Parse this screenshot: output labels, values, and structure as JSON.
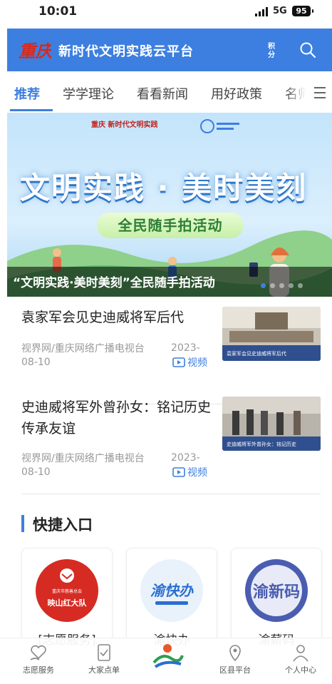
{
  "status_bar": {
    "time": "10:01",
    "network": "5G",
    "battery": "95"
  },
  "header": {
    "logo_text": "重庆",
    "title": "新时代文明实践云平台",
    "points_label": "积分",
    "brand_color": "#3d7fe0"
  },
  "tabs": [
    {
      "label": "推荐",
      "active": true
    },
    {
      "label": "学学理论",
      "active": false
    },
    {
      "label": "看看新闻",
      "active": false
    },
    {
      "label": "用好政策",
      "active": false
    },
    {
      "label": "名师",
      "active": false
    }
  ],
  "banner": {
    "top_logo_text": "重庆 新时代文明实践",
    "headline": "文明实践 · 美时美刻",
    "pill": "全民随手拍活动",
    "caption": "“文明实践·美时美刻”全民随手拍活动",
    "slide_count": 5,
    "active_slide": 1
  },
  "news": [
    {
      "title": "袁家军会见史迪威将军后代",
      "source": "视界网/重庆网络广播电视台",
      "date_part1": "2023-",
      "date_part2": "08-10",
      "media_label": "视频",
      "thumb_text": "袁家军会见史迪威将军后代"
    },
    {
      "title": "史迪威将军外曾孙女：铭记历史 传承友谊",
      "source": "视界网/重庆网络广播电视台",
      "date_part1": "2023-",
      "date_part2": "08-10",
      "media_label": "视频",
      "thumb_text": "史迪威将军外曾孙女：铭记历史"
    }
  ],
  "quick_access": {
    "title": "快捷入口",
    "items": [
      {
        "label": "[志愿服务]",
        "icon_text": "映山红大队",
        "icon_subtext": "重庆市慈善总会"
      },
      {
        "label": "渝快办",
        "icon_text": "渝快办"
      },
      {
        "label": "渝薪码",
        "icon_text": "渝新码"
      }
    ]
  },
  "tab_bar": [
    {
      "label": "志愿服务",
      "icon": "heart-hand-icon"
    },
    {
      "label": "大家点单",
      "icon": "checklist-icon"
    },
    {
      "label": "",
      "icon": "home-logo-icon"
    },
    {
      "label": "区县平台",
      "icon": "map-pin-icon"
    },
    {
      "label": "个人中心",
      "icon": "person-icon"
    }
  ]
}
